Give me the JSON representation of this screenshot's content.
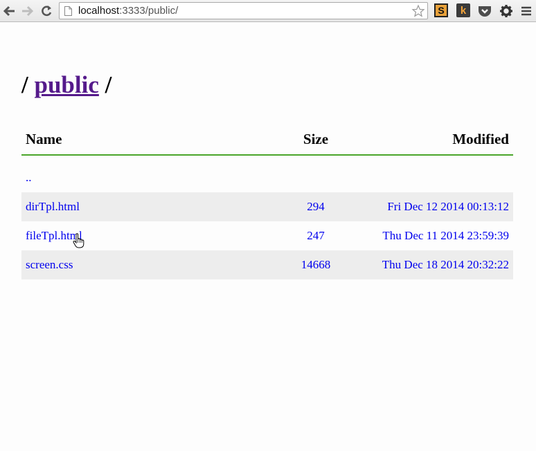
{
  "browser": {
    "url_host": "localhost",
    "url_rest": ":3333/public/",
    "icons": [
      "back-icon",
      "forward-icon",
      "reload-icon",
      "page-icon",
      "star-icon",
      "pocket-icon",
      "gear-icon",
      "menu-icon"
    ],
    "extensions": {
      "s_label": "S",
      "k_label": "k"
    }
  },
  "page": {
    "heading_prefix": "/",
    "heading_link": "public",
    "heading_suffix": "/"
  },
  "table": {
    "columns": {
      "name": "Name",
      "size": "Size",
      "modified": "Modified"
    },
    "parent_link": "..",
    "rows": [
      {
        "name": "dirTpl.html",
        "size": "294",
        "modified": "Fri Dec 12 2014 00:13:12"
      },
      {
        "name": "fileTpl.html",
        "size": "247",
        "modified": "Thu Dec 11 2014 23:59:39"
      },
      {
        "name": "screen.css",
        "size": "14668",
        "modified": "Thu Dec 18 2014 20:32:22"
      }
    ]
  },
  "colors": {
    "link": "#0000ee",
    "visited_link": "#551a8b",
    "header_rule": "#4aa52a",
    "row_stripe": "#ededed"
  }
}
